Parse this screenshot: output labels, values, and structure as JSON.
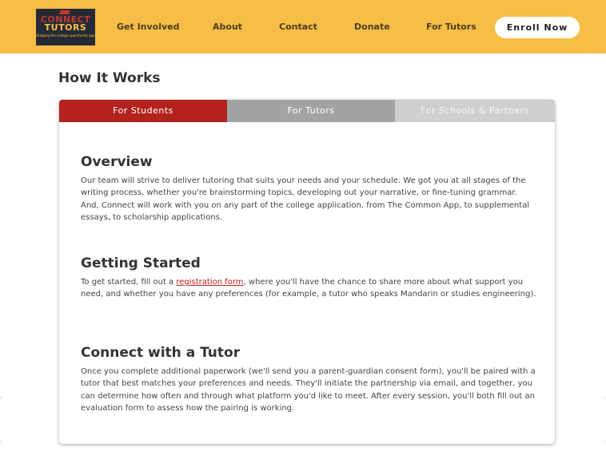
{
  "header": {
    "logo": {
      "line1": "CONNECT",
      "line2": "TUTORS",
      "tagline": "Bridging the college opportunity gap"
    },
    "nav": [
      "Get Involved",
      "About",
      "Contact",
      "Donate",
      "For Tutors"
    ],
    "cta": "Enroll Now",
    "colors": {
      "bar": "#f7bd47",
      "logo_bg": "#262a35",
      "accent": "#b3221d"
    }
  },
  "page": {
    "title": "How It Works"
  },
  "tabs": [
    {
      "label": "For Students",
      "active": true
    },
    {
      "label": "For Tutors",
      "active": false
    },
    {
      "label": "For Schools & Partners",
      "active": false
    }
  ],
  "sections": {
    "overview": {
      "heading": "Overview",
      "text": "Our team will strive to deliver tutoring that suits your needs and your schedule. We got you at all stages of the writing process, whether you're brainstorming topics, developing out your narrative, or fine-tuning grammar. And, Connect will work with you on any part of the college application, from The Common App, to supplemental essays, to scholarship applications."
    },
    "getting_started": {
      "heading": "Getting Started",
      "text_before": "To get started, fill out a ",
      "link": "registration form",
      "text_after": ", where you'll have the chance to share more about what support you need, and whether you have any preferences (for example, a tutor who speaks Mandarin or studies engineering)."
    },
    "connect": {
      "heading": "Connect with a Tutor",
      "text": "Once you complete additional paperwork (we'll send you a parent-guardian consent form), you'll be paired with a tutor that best matches your preferences and needs. They'll initiate the partnership via email, and together, you can determine how often and through what platform you'd like to meet. After every session, you'll both fill out an evaluation form to assess how the pairing is working."
    }
  }
}
